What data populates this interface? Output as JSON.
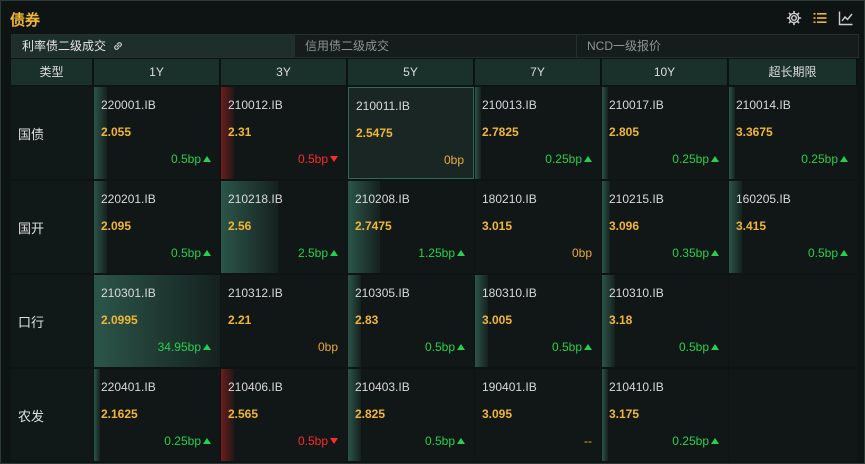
{
  "app": {
    "title": "债券"
  },
  "tabs": [
    {
      "label": "利率债二级成交",
      "active": true
    },
    {
      "label": "信用债二级成交",
      "active": false
    },
    {
      "label": "NCD一级报价",
      "active": false
    }
  ],
  "columns": [
    "类型",
    "1Y",
    "3Y",
    "5Y",
    "7Y",
    "10Y",
    "超长期限"
  ],
  "rows": [
    {
      "label": "国债",
      "cells": [
        {
          "code": "220001.IB",
          "yield": "2.055",
          "change": "0.5bp",
          "dir": "up",
          "bar": 0.1
        },
        {
          "code": "210012.IB",
          "yield": "2.31",
          "change": "0.5bp",
          "dir": "down",
          "bar": 0.1
        },
        {
          "code": "210011.IB",
          "yield": "2.5475",
          "change": "0bp",
          "dir": "flat",
          "bar": 0,
          "selected": true
        },
        {
          "code": "210013.IB",
          "yield": "2.7825",
          "change": "0.25bp",
          "dir": "up",
          "bar": 0.05
        },
        {
          "code": "210017.IB",
          "yield": "2.805",
          "change": "0.25bp",
          "dir": "up",
          "bar": 0.05
        },
        {
          "code": "210014.IB",
          "yield": "3.3675",
          "change": "0.25bp",
          "dir": "up",
          "bar": 0.05
        }
      ]
    },
    {
      "label": "国开",
      "cells": [
        {
          "code": "220201.IB",
          "yield": "2.095",
          "change": "0.5bp",
          "dir": "up",
          "bar": 0.1
        },
        {
          "code": "210218.IB",
          "yield": "2.56",
          "change": "2.5bp",
          "dir": "up",
          "bar": 0.45
        },
        {
          "code": "210208.IB",
          "yield": "2.7475",
          "change": "1.25bp",
          "dir": "up",
          "bar": 0.25
        },
        {
          "code": "180210.IB",
          "yield": "3.015",
          "change": "0bp",
          "dir": "flat",
          "bar": 0
        },
        {
          "code": "210215.IB",
          "yield": "3.096",
          "change": "0.35bp",
          "dir": "up",
          "bar": 0.06
        },
        {
          "code": "160205.IB",
          "yield": "3.415",
          "change": "0.5bp",
          "dir": "up",
          "bar": 0.1
        }
      ]
    },
    {
      "label": "口行",
      "cells": [
        {
          "code": "210301.IB",
          "yield": "2.0995",
          "change": "34.95bp",
          "dir": "up",
          "bar": 1.0
        },
        {
          "code": "210312.IB",
          "yield": "2.21",
          "change": "0bp",
          "dir": "flat",
          "bar": 0
        },
        {
          "code": "210305.IB",
          "yield": "2.83",
          "change": "0.5bp",
          "dir": "up",
          "bar": 0.1
        },
        {
          "code": "180310.IB",
          "yield": "3.005",
          "change": "0.5bp",
          "dir": "up",
          "bar": 0.1
        },
        {
          "code": "210310.IB",
          "yield": "3.18",
          "change": "0.5bp",
          "dir": "up",
          "bar": 0.1
        },
        null
      ]
    },
    {
      "label": "农发",
      "cells": [
        {
          "code": "220401.IB",
          "yield": "2.1625",
          "change": "0.25bp",
          "dir": "up",
          "bar": 0.05
        },
        {
          "code": "210406.IB",
          "yield": "2.565",
          "change": "0.5bp",
          "dir": "down",
          "bar": 0.1
        },
        {
          "code": "210403.IB",
          "yield": "2.825",
          "change": "0.5bp",
          "dir": "up",
          "bar": 0.1
        },
        {
          "code": "190401.IB",
          "yield": "3.095",
          "change": "--",
          "dir": "none",
          "bar": 0
        },
        {
          "code": "210410.IB",
          "yield": "3.175",
          "change": "0.25bp",
          "dir": "up",
          "bar": 0.05
        },
        null
      ]
    }
  ],
  "icons": {
    "settings": "gear-icon",
    "list": "list-icon",
    "chart": "line-chart-icon",
    "link": "link-icon"
  },
  "colors": {
    "accent": "#f1b635",
    "up": "#26d04e",
    "down": "#ff2b2b",
    "flat": "#e9a93a"
  }
}
